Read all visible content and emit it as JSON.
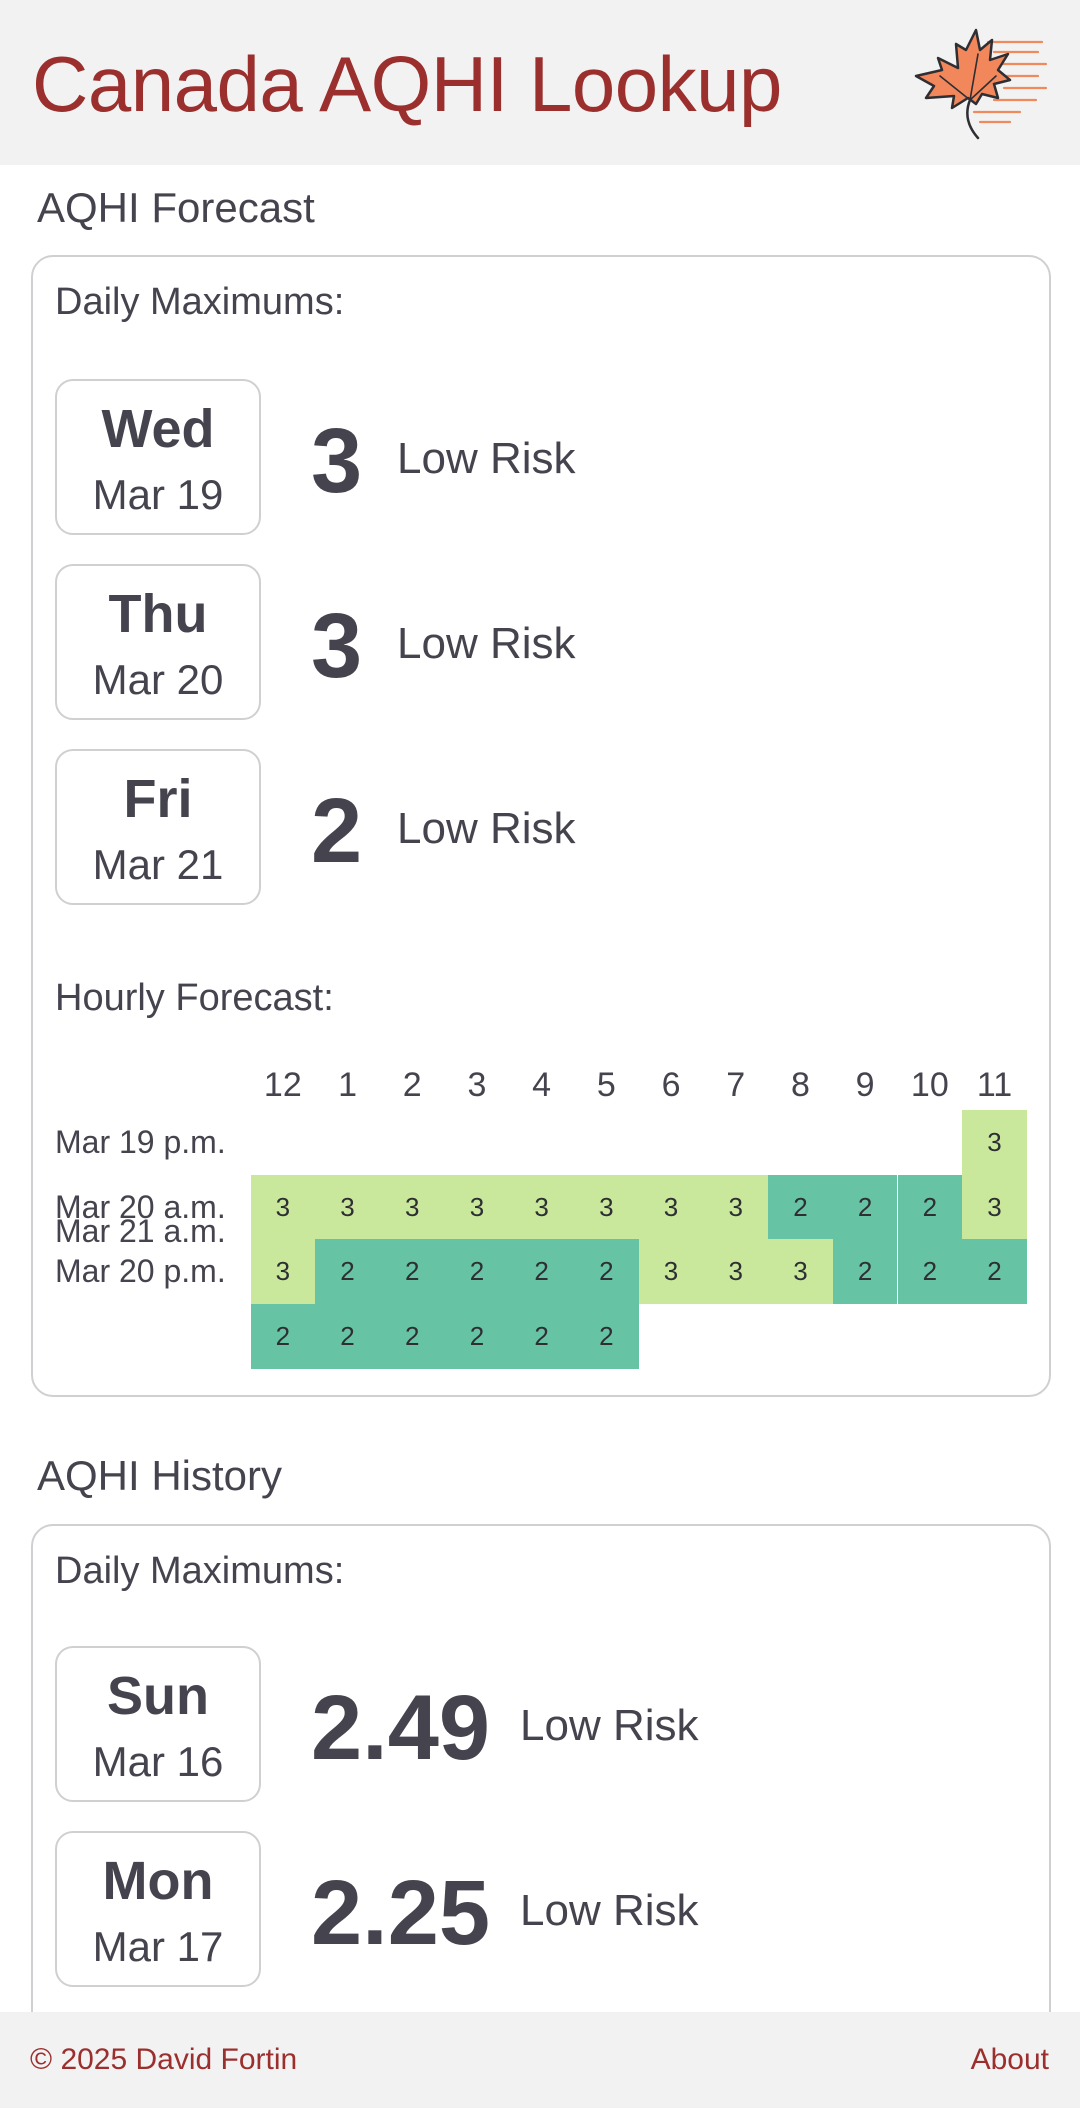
{
  "app": {
    "title": "Canada AQHI Lookup",
    "logo_icon": "maple-leaf-icon",
    "brand_color": "#9b2f2d"
  },
  "forecast": {
    "title": "AQHI Forecast",
    "daily_label": "Daily Maximums:",
    "days": [
      {
        "dow": "Wed",
        "date": "Mar 19",
        "value": "3",
        "risk": "Low Risk"
      },
      {
        "dow": "Thu",
        "date": "Mar 20",
        "value": "3",
        "risk": "Low Risk"
      },
      {
        "dow": "Fri",
        "date": "Mar 21",
        "value": "2",
        "risk": "Low Risk"
      }
    ],
    "hourly": {
      "label": "Hourly Forecast:",
      "hours": [
        "12",
        "1",
        "2",
        "3",
        "4",
        "5",
        "6",
        "7",
        "8",
        "9",
        "10",
        "11"
      ],
      "rows": [
        {
          "label": "Mar 19 p.m.",
          "values": [
            null,
            null,
            null,
            null,
            null,
            null,
            null,
            null,
            null,
            null,
            null,
            3
          ]
        },
        {
          "label": "Mar 20 a.m.",
          "values": [
            3,
            3,
            3,
            3,
            3,
            3,
            3,
            3,
            2,
            2,
            2,
            3
          ]
        },
        {
          "label": "Mar 20 p.m.",
          "values": [
            3,
            2,
            2,
            2,
            2,
            2,
            3,
            3,
            3,
            2,
            2,
            2
          ]
        },
        {
          "label": "Mar 21 a.m.",
          "values": [
            2,
            2,
            2,
            2,
            2,
            2,
            null,
            null,
            null,
            null,
            null,
            null
          ]
        }
      ],
      "colors": {
        "2": "#66c4a5",
        "3": "#c9e89c"
      }
    }
  },
  "history": {
    "title": "AQHI History",
    "daily_label": "Daily Maximums:",
    "days": [
      {
        "dow": "Sun",
        "date": "Mar 16",
        "value": "2.49",
        "risk": "Low Risk"
      },
      {
        "dow": "Mon",
        "date": "Mar 17",
        "value": "2.25",
        "risk": "Low Risk"
      }
    ]
  },
  "footer": {
    "copyright": "© 2025 David Fortin",
    "about": "About"
  }
}
